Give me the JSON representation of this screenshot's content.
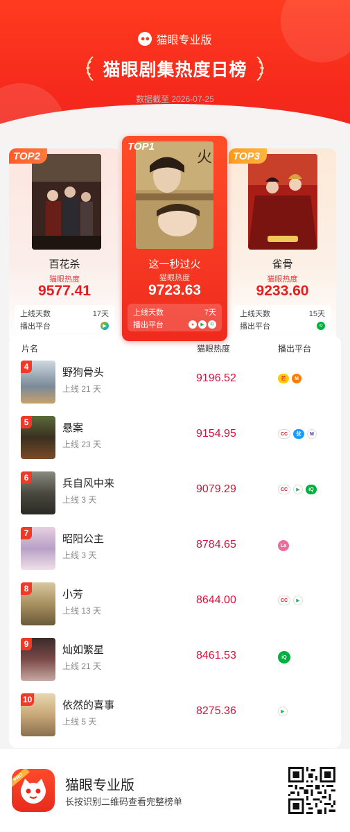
{
  "header": {
    "brand": "猫眼专业版",
    "title": "猫眼剧集热度日榜",
    "date": "数据截至 2026-07-25",
    "colors": {
      "primary": "#f5281c",
      "heat_red": "#d4143c"
    }
  },
  "top3": [
    {
      "rank_tag": "TOP2",
      "name": "百花杀",
      "heat_label": "猫眼热度",
      "heat": "9577.41",
      "days_label": "上线天数",
      "days": "17天",
      "platform_label": "播出平台",
      "platforms": [
        "tencent-video-icon"
      ]
    },
    {
      "rank_tag": "TOP1",
      "name": "这一秒过火",
      "heat_label": "猫眼热度",
      "heat": "9723.63",
      "days_label": "上线天数",
      "days": "7天",
      "platform_label": "播出平台",
      "platforms": [
        "mango-tv-icon",
        "tencent-video-icon",
        "iqiyi-icon"
      ]
    },
    {
      "rank_tag": "TOP3",
      "name": "雀骨",
      "heat_label": "猫眼热度",
      "heat": "9233.60",
      "days_label": "上线天数",
      "days": "15天",
      "platform_label": "播出平台",
      "platforms": [
        "iqiyi-icon"
      ]
    }
  ],
  "list": {
    "headers": {
      "name": "片名",
      "heat": "猫眼热度",
      "platform": "播出平台"
    },
    "rows": [
      {
        "rank": "4",
        "title": "野狗骨头",
        "days": "上线 21 天",
        "heat": "9196.52",
        "platforms": [
          "hunan-tv-icon",
          "mango-tv-icon"
        ]
      },
      {
        "rank": "5",
        "title": "悬案",
        "days": "上线 23 天",
        "heat": "9154.95",
        "platforms": [
          "cctv-icon",
          "youku-icon",
          "migu-icon"
        ]
      },
      {
        "rank": "6",
        "title": "兵自风中来",
        "days": "上线 3 天",
        "heat": "9079.29",
        "platforms": [
          "cctv-icon",
          "tencent-video-icon",
          "iqiyi-icon"
        ]
      },
      {
        "rank": "7",
        "title": "昭阳公主",
        "days": "上线 3 天",
        "heat": "8784.65",
        "platforms": [
          "lala-icon"
        ]
      },
      {
        "rank": "8",
        "title": "小芳",
        "days": "上线 13 天",
        "heat": "8644.00",
        "platforms": [
          "cctv-icon",
          "tencent-video-icon"
        ]
      },
      {
        "rank": "9",
        "title": "灿如繁星",
        "days": "上线 21 天",
        "heat": "8461.53",
        "platforms": [
          "iqiyi-icon"
        ]
      },
      {
        "rank": "10",
        "title": "依然的喜事",
        "days": "上线 5 天",
        "heat": "8275.36",
        "platforms": [
          "tencent-video-icon"
        ]
      }
    ]
  },
  "footer": {
    "app_name": "猫眼专业版",
    "hint": "长按识别二维码查看完整榜单",
    "pro_badge": "PRO"
  }
}
